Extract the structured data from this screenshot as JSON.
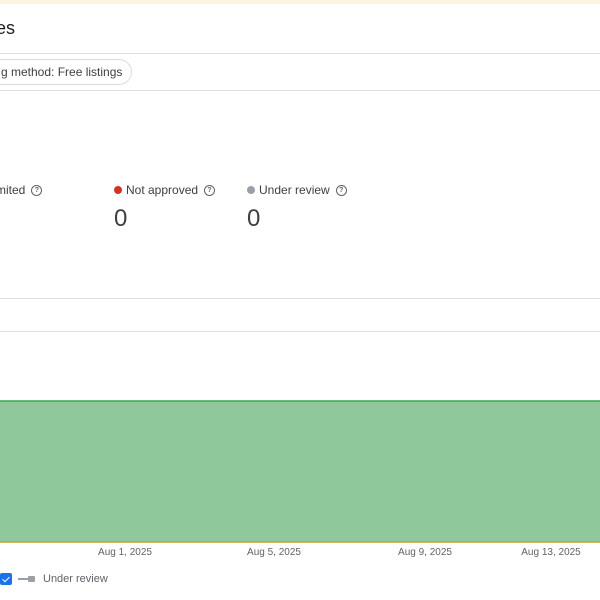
{
  "header": {
    "title": "es"
  },
  "filters": {
    "chip_label": "g method: Free listings"
  },
  "metrics": [
    {
      "label": "mited",
      "value": "",
      "color": ""
    },
    {
      "label": "Not approved",
      "value": "0",
      "color": "#d93025"
    },
    {
      "label": "Under review",
      "value": "0",
      "color": "#9aa0a6"
    }
  ],
  "chart_data": {
    "type": "area",
    "x_tick_labels": [
      "Aug 1, 2025",
      "Aug 5, 2025",
      "Aug 9, 2025",
      "Aug 13, 2025"
    ],
    "series": [
      {
        "color": "#8fc89b",
        "line_color": "#34a853"
      }
    ],
    "grid": false
  },
  "legend": {
    "items": [
      {
        "label": "Under review",
        "checked": true,
        "color": "#9aa0a6"
      }
    ]
  }
}
